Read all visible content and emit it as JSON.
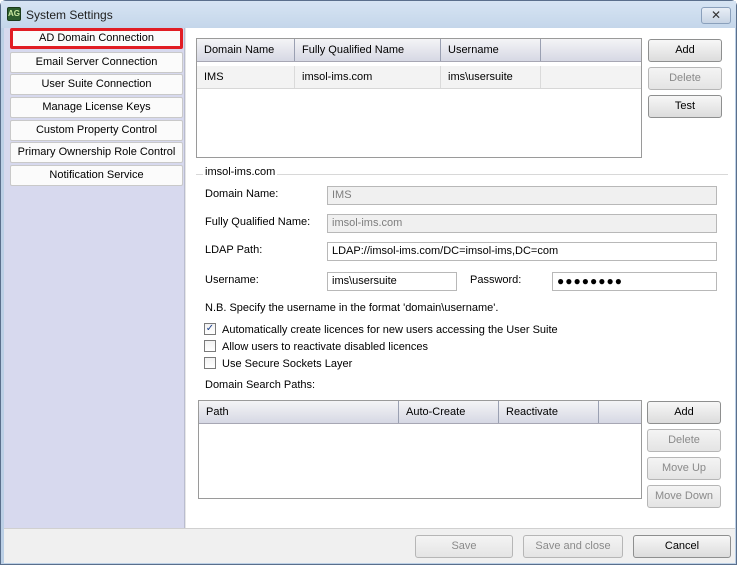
{
  "window": {
    "title": "System Settings",
    "icon_text": "AG",
    "close_glyph": "✕"
  },
  "sidebar": {
    "items": [
      {
        "label": "AD Domain Connection",
        "active": true
      },
      {
        "label": "Email Server Connection"
      },
      {
        "label": "User Suite Connection"
      },
      {
        "label": "Manage License Keys"
      },
      {
        "label": "Custom Property Control"
      },
      {
        "label": "Primary Ownership Role Control"
      },
      {
        "label": "Notification Service"
      }
    ]
  },
  "domains_table": {
    "columns": [
      "Domain Name",
      "Fully Qualified Name",
      "Username",
      ""
    ],
    "rows": [
      [
        "IMS",
        "imsol-ims.com",
        "ims\\usersuite"
      ]
    ],
    "buttons": {
      "add": "Add",
      "delete": "Delete",
      "test": "Test"
    }
  },
  "details": {
    "group_title": "imsol-ims.com",
    "domain_name_label": "Domain Name:",
    "domain_name_value": "IMS",
    "fqn_label": "Fully Qualified Name:",
    "fqn_value": "imsol-ims.com",
    "ldap_label": "LDAP Path:",
    "ldap_value": "LDAP://imsol-ims.com/DC=imsol-ims,DC=com",
    "username_label": "Username:",
    "username_value": "ims\\usersuite",
    "password_label": "Password:",
    "password_value": "●●●●●●●●",
    "note": "N.B. Specify the username in the format 'domain\\username'.",
    "checkboxes": [
      {
        "label": "Automatically create licences for new users accessing the User Suite",
        "checked": true
      },
      {
        "label": "Allow users to reactivate disabled licences",
        "checked": false
      },
      {
        "label": "Use Secure Sockets Layer",
        "checked": false
      }
    ],
    "check_glyph": "✓",
    "search_paths_label": "Domain Search Paths:"
  },
  "search_paths_table": {
    "columns": [
      "Path",
      "Auto-Create",
      "Reactivate",
      ""
    ],
    "buttons": {
      "add": "Add",
      "delete": "Delete",
      "move_up": "Move Up",
      "move_down": "Move Down"
    }
  },
  "footer": {
    "save": "Save",
    "save_close": "Save and close",
    "cancel": "Cancel"
  }
}
